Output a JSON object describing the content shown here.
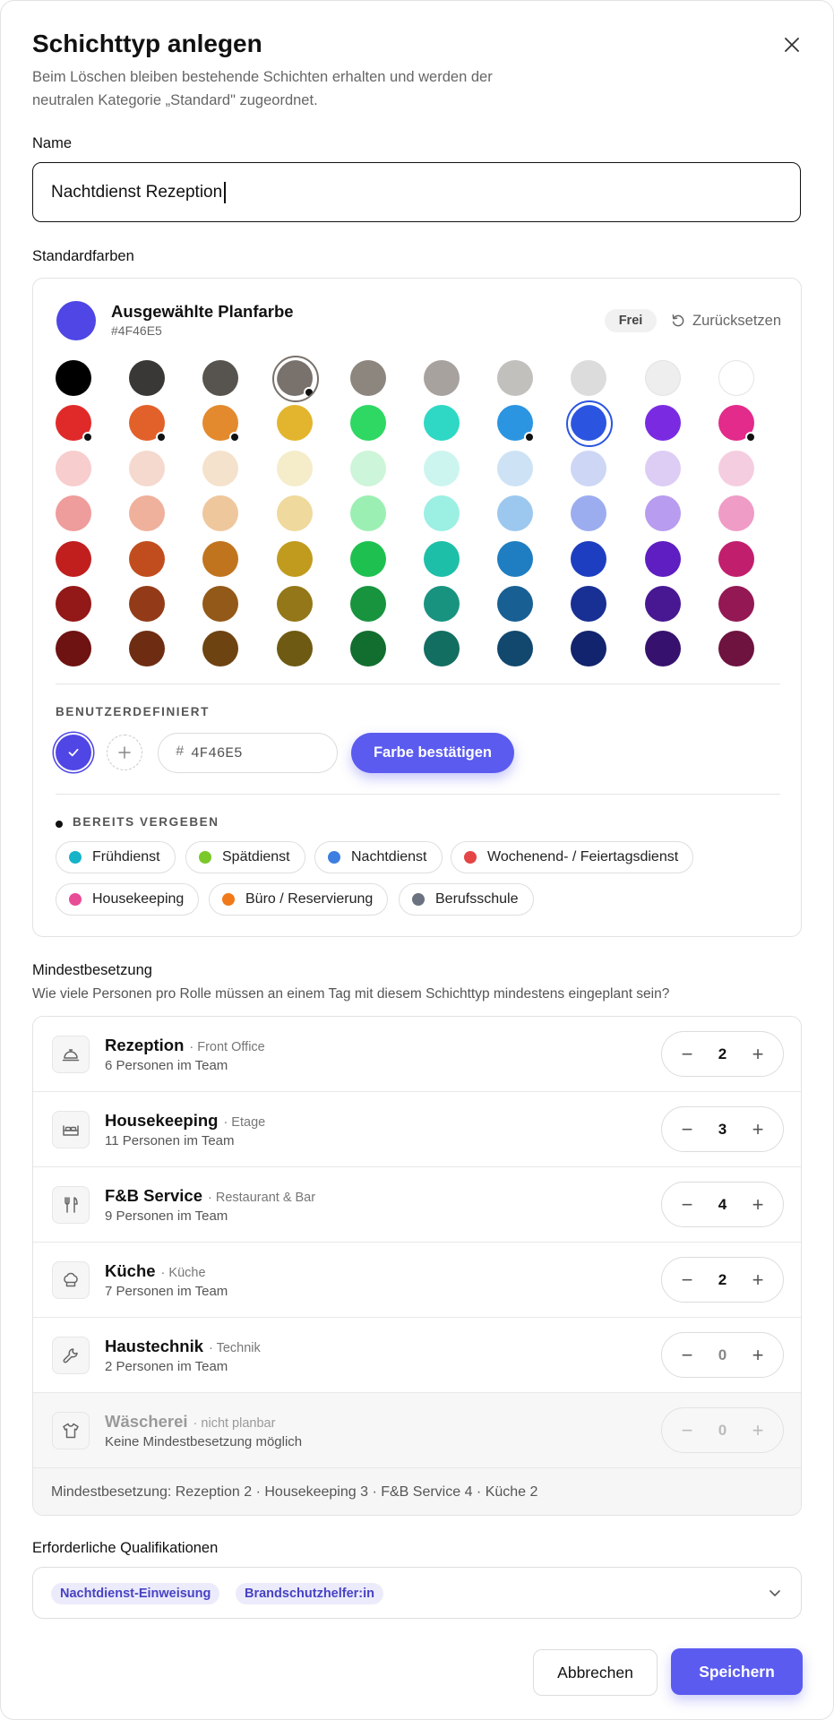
{
  "dialog": {
    "title": "Schichttyp anlegen",
    "subtitle": "Beim Löschen bleiben bestehende Schichten erhalten und werden der neutralen Kategorie „Standard\" zugeordnet.",
    "close_icon": "close-icon"
  },
  "name_field": {
    "label": "Name",
    "value": "Nachtdienst Rezeption"
  },
  "colors": {
    "section_label": "Standardfarben",
    "selected_title": "Ausgewählte Planfarbe",
    "selected_hex": "#4F46E5",
    "selected_color": "#4F46E5",
    "status_badge": "Frei",
    "reset_label": "Zurücksetzen",
    "palette": [
      [
        "#000000",
        "#3a3836",
        "#57534e",
        "#78716c",
        "#8d867f",
        "#a8a29e",
        "#c2c0bd",
        "#dcdcdc",
        "#eeeeee",
        "#ffffff"
      ],
      [
        "#e02a2a",
        "#e2612a",
        "#e38a2e",
        "#e3b52e",
        "#2ed862",
        "#2ed8c4",
        "#2b95e2",
        "#2b55e0",
        "#7a2be2",
        "#e22b8a"
      ],
      [
        "#f7cdcd",
        "#f5d9ce",
        "#f5e2cc",
        "#f5ecca",
        "#cdf5d9",
        "#cdf5ef",
        "#cde3f5",
        "#cdd6f5",
        "#ddcdf5",
        "#f5cde0"
      ],
      [
        "#ef9c9c",
        "#efb09c",
        "#efc79c",
        "#efd99c",
        "#9cefb3",
        "#9cefe3",
        "#9cc8ef",
        "#9cadef",
        "#b89cef",
        "#ef9cc6"
      ],
      [
        "#c11e1e",
        "#c14d1e",
        "#c1741e",
        "#c19b1e",
        "#1ec150",
        "#1ebfa8",
        "#1e7ec1",
        "#1e3ec1",
        "#5e1ec1",
        "#c11e6e"
      ],
      [
        "#931818",
        "#933b18",
        "#935918",
        "#937718",
        "#18933e",
        "#189380",
        "#186093",
        "#183093",
        "#481893",
        "#931854"
      ],
      [
        "#6e1212",
        "#6e2d12",
        "#6e4312",
        "#6e5a12",
        "#126e2f",
        "#126e60",
        "#12486e",
        "#12246e",
        "#36126e",
        "#6e123f"
      ]
    ],
    "used_colors": [
      "#78716c",
      "#e02a2a",
      "#e2612a",
      "#e38a2e",
      "#2b95e2",
      "#e22b8a"
    ],
    "custom_label": "BENUTZERDEFINIERT",
    "custom_color": "#4F46E5",
    "hex_prefix": "#",
    "hex_value": "4F46E5",
    "confirm_label": "Farbe bestätigen",
    "taken_label": "BEREITS VERGEBEN",
    "taken": [
      {
        "label": "Frühdienst",
        "color": "#17b3c8"
      },
      {
        "label": "Spätdienst",
        "color": "#7ac82a"
      },
      {
        "label": "Nachtdienst",
        "color": "#3d7fe0"
      },
      {
        "label": "Wochenend- / Feiertagsdienst",
        "color": "#e54545"
      },
      {
        "label": "Housekeeping",
        "color": "#e84c97"
      },
      {
        "label": "Büro / Reservierung",
        "color": "#f07a1a"
      },
      {
        "label": "Berufsschule",
        "color": "#6b7280"
      }
    ]
  },
  "staffing": {
    "section_label": "Mindestbesetzung",
    "description": "Wie viele Personen pro Rolle müssen an einem Tag mit diesem Schichttyp mindestens eingeplant sein?",
    "roles": [
      {
        "name": "Rezeption",
        "dept": "· Front Office",
        "sub": "6 Personen im Team",
        "value": "2",
        "icon": "bell-icon",
        "disabled": false
      },
      {
        "name": "Housekeeping",
        "dept": "· Etage",
        "sub": "11 Personen im Team",
        "value": "3",
        "icon": "bed-icon",
        "disabled": false
      },
      {
        "name": "F&B Service",
        "dept": "· Restaurant & Bar",
        "sub": "9 Personen im Team",
        "value": "4",
        "icon": "cutlery-icon",
        "disabled": false
      },
      {
        "name": "Küche",
        "dept": "· Küche",
        "sub": "7 Personen im Team",
        "value": "2",
        "icon": "chef-hat-icon",
        "disabled": false
      },
      {
        "name": "Haustechnik",
        "dept": "· Technik",
        "sub": "2 Personen im Team",
        "value": "0",
        "icon": "wrench-icon",
        "disabled": false
      },
      {
        "name": "Wäscherei",
        "dept": "· nicht planbar",
        "sub": "Keine Mindestbesetzung möglich",
        "value": "0",
        "icon": "shirt-icon",
        "disabled": true
      }
    ],
    "minus_symbol": "−",
    "plus_symbol": "+",
    "summary": "Mindestbesetzung: Rezeption 2 · Housekeeping 3 · F&B Service 4 · Küche 2"
  },
  "qualifications": {
    "section_label": "Erforderliche Qualifikationen",
    "tags": [
      "Nachtdienst-Einweisung",
      "Brandschutzhelfer:in"
    ]
  },
  "footer": {
    "cancel_label": "Abbrechen",
    "save_label": "Speichern"
  },
  "theme": {
    "accent": "#5b5bf0",
    "tag_bg": "#ecebfb",
    "tag_text": "#4842c4"
  }
}
